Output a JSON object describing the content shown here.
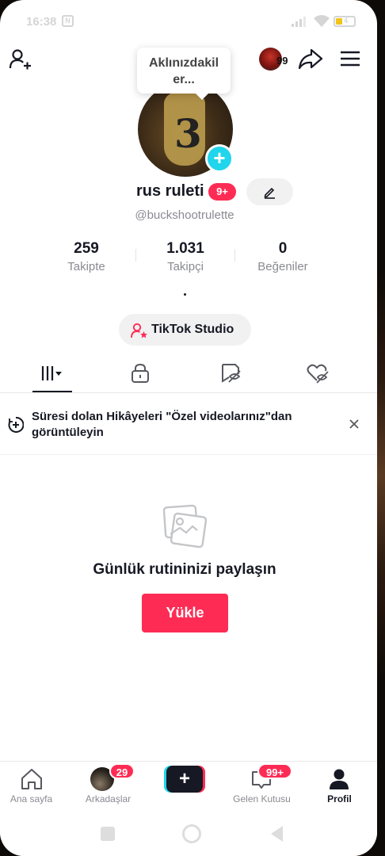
{
  "status_bar": {
    "time": "16:38",
    "nfc": "N",
    "battery": "4"
  },
  "header": {
    "tooltip_text": "Aklınızdakil er...",
    "follower_pill_count": "99",
    "icons": [
      "add-friend-icon",
      "share-icon",
      "menu-icon"
    ]
  },
  "profile": {
    "display_name": "rus ruleti",
    "name_badge": "9+",
    "username": "@buckshootrulette",
    "bio": ".",
    "stats": [
      {
        "value": "259",
        "label": "Takipte"
      },
      {
        "value": "1.031",
        "label": "Takipçi"
      },
      {
        "value": "0",
        "label": "Beğeniler"
      }
    ],
    "studio_button": "TikTok Studio"
  },
  "tabs": [
    "videos-grid-icon",
    "private-lock-icon",
    "reposts-icon",
    "liked-icon"
  ],
  "banner": {
    "text": "Süresi dolan Hikâyeleri \"Özel videolarınız\"dan görüntüleyin"
  },
  "empty_state": {
    "title": "Günlük rutininizi paylaşın",
    "button": "Yükle"
  },
  "bottom_nav": {
    "items": [
      {
        "label": "Ana sayfa"
      },
      {
        "label": "Arkadaşlar",
        "badge": "29"
      },
      {
        "label": "Gelen Kutusu",
        "badge": "99+"
      },
      {
        "label": "Profil"
      }
    ]
  },
  "colors": {
    "accent": "#fe2c55",
    "cyan": "#20d5ec",
    "text": "#161823",
    "muted": "#8a8b91"
  }
}
